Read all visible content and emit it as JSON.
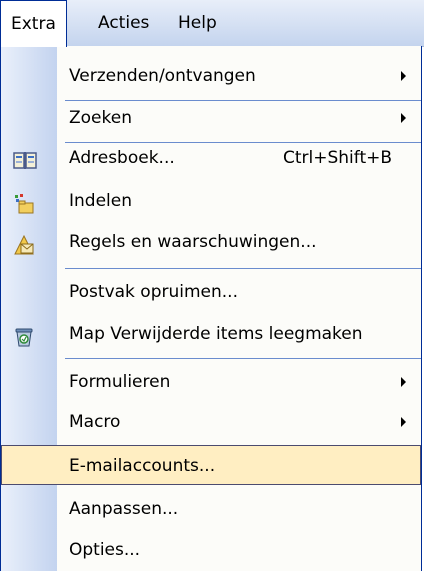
{
  "menubar": {
    "items": [
      {
        "label": "Extra"
      },
      {
        "label": "Acties"
      },
      {
        "label": "Help"
      }
    ]
  },
  "menu": {
    "items": [
      {
        "label": "Verzenden/ontvangen",
        "submenu": true
      },
      {
        "label": "Zoeken",
        "submenu": true
      },
      {
        "label": "Adresboek...",
        "shortcut": "Ctrl+Shift+B",
        "icon": "address-book-icon"
      },
      {
        "label": "Indelen",
        "icon": "organize-icon"
      },
      {
        "label": "Regels en waarschuwingen...",
        "icon": "rules-icon"
      },
      {
        "label": "Postvak opruimen..."
      },
      {
        "label": "Map Verwijderde items leegmaken",
        "icon": "empty-trash-icon"
      },
      {
        "label": "Formulieren",
        "submenu": true
      },
      {
        "label": "Macro",
        "submenu": true
      },
      {
        "label": "E-mailaccounts...",
        "highlighted": true
      },
      {
        "label": "Aanpassen..."
      },
      {
        "label": "Opties..."
      }
    ]
  },
  "colors": {
    "highlight_bg": "#ffeec2",
    "separator": "#6a8cce",
    "menu_border": "#002d96"
  }
}
